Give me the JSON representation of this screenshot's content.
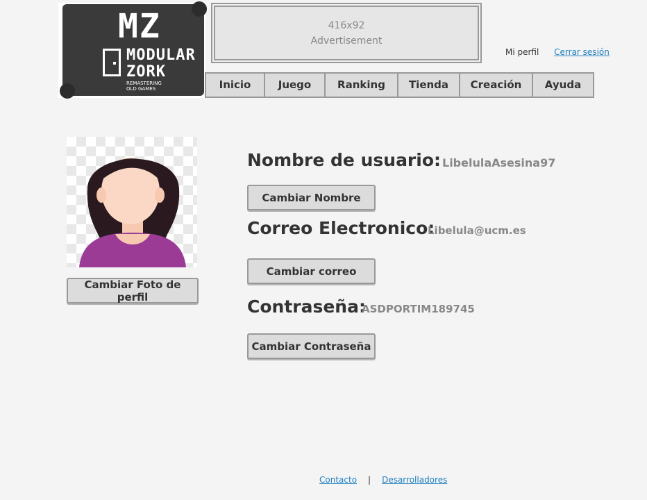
{
  "logo": {
    "mz": "MZ",
    "line1": "MODULAR",
    "line2": "ZORK",
    "sub1": "REMASTERING",
    "sub2": "OLD GAMES"
  },
  "ad": {
    "size": "416x92",
    "label": "Advertisement"
  },
  "header": {
    "profile_link": "Mi perfil",
    "logout_link": "Cerrar sesión"
  },
  "nav": {
    "items": [
      "Inicio",
      "Juego",
      "Ranking",
      "Tienda",
      "Creación",
      "Ayuda"
    ]
  },
  "profile": {
    "change_photo_label": "Cambiar Foto de perfil",
    "username_label": "Nombre de usuario:",
    "username_value": "LibelulaAsesina97",
    "change_name_label": "Cambiar Nombre",
    "email_label": "Correo Electronico:",
    "email_value": "Libelula@ucm.es",
    "change_email_label": "Cambiar correo",
    "password_label": "Contraseña:",
    "password_value": "ASDPORTIM189745",
    "change_password_label": "Cambiar Contraseña"
  },
  "footer": {
    "contact": "Contacto",
    "separator": "|",
    "developers": "Desarrolladores"
  },
  "colors": {
    "background": "#f4f4f4",
    "link": "#1f7fc0",
    "button": "#dcdcdc",
    "border": "#999999"
  }
}
